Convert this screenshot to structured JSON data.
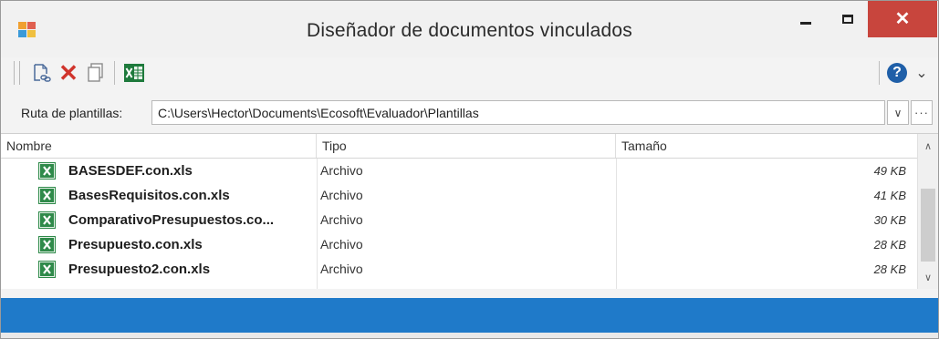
{
  "window": {
    "title": "Diseñador de documentos vinculados",
    "close_glyph": "✕"
  },
  "toolbar": {
    "icons": [
      "link-document-icon",
      "delete-icon",
      "copy-icon",
      "excel-icon",
      "help-icon",
      "chevron-down-icon"
    ],
    "delete_glyph": "✕",
    "help_glyph": "?",
    "overflow_glyph": "⌄"
  },
  "path": {
    "label": "Ruta de plantillas:",
    "value": "C:\\Users\\Hector\\Documents\\Ecosoft\\Evaluador\\Plantillas",
    "dropdown_glyph": "∨",
    "more_glyph": "···"
  },
  "table": {
    "columns": [
      "Nombre",
      "Tipo",
      "Tamaño"
    ],
    "rows": [
      {
        "name": "BASESDEF.con.xls",
        "type": "Archivo",
        "size": "49 KB"
      },
      {
        "name": "BasesRequisitos.con.xls",
        "type": "Archivo",
        "size": "41 KB"
      },
      {
        "name": "ComparativoPresupuestos.co...",
        "type": "Archivo",
        "size": "30 KB"
      },
      {
        "name": "Presupuesto.con.xls",
        "type": "Archivo",
        "size": "28 KB"
      },
      {
        "name": "Presupuesto2.con.xls",
        "type": "Archivo",
        "size": "28 KB"
      }
    ]
  },
  "scroll": {
    "up_glyph": "∧",
    "down_glyph": "∨"
  },
  "colors": {
    "accent": "#1f7ac9",
    "close": "#c8453d",
    "excel": "#1e7a3c",
    "help": "#1f5fa8"
  }
}
